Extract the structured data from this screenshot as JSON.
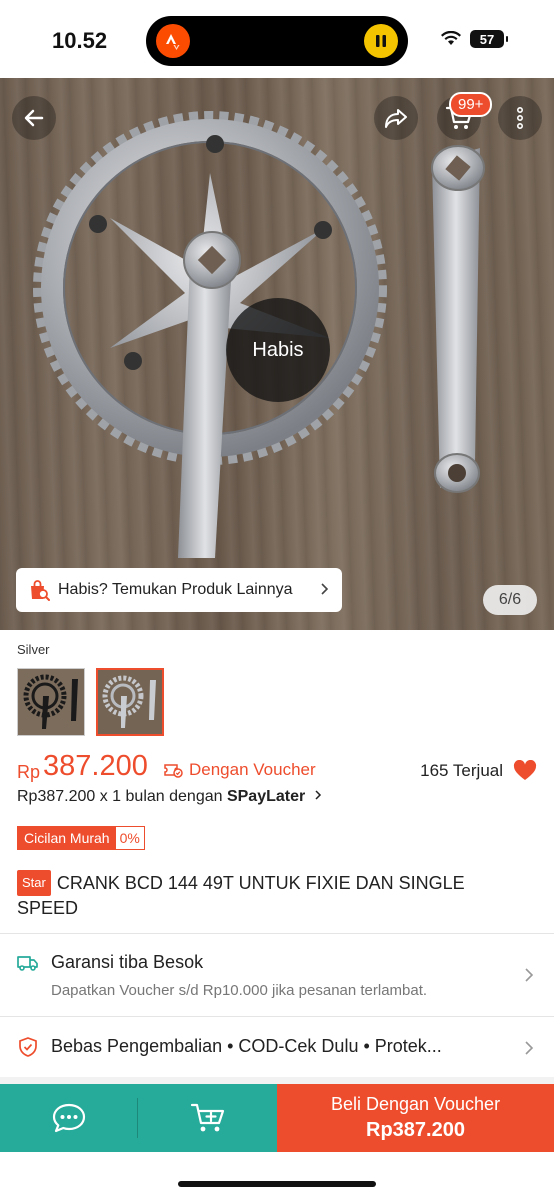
{
  "status": {
    "time": "10.52",
    "battery": "57"
  },
  "hero": {
    "habis_label": "Habis",
    "find_other_label": "Habis? Temukan Produk Lainnya",
    "image_counter": "6/6",
    "cart_badge": "99+"
  },
  "variant": {
    "label": "Silver",
    "selected_index": 1
  },
  "pricing": {
    "currency": "Rp",
    "price": "387.200",
    "voucher_label": "Dengan Voucher",
    "sold": "165 Terjual",
    "installment_prefix": "Rp387.200 x 1 bulan dengan ",
    "installment_brand": "SPayLater",
    "cicilan_label": "Cicilan Murah",
    "cicilan_rate": "0%"
  },
  "product": {
    "tag": "Star",
    "title": "CRANK BCD 144 49T UNTUK FIXIE DAN SINGLE SPEED"
  },
  "shipping": {
    "title": "Garansi tiba Besok",
    "subtitle": "Dapatkan Voucher s/d Rp10.000 jika pesanan terlambat."
  },
  "features": {
    "text": "Bebas Pengembalian  •  COD-Cek Dulu  •  Protek..."
  },
  "bottom": {
    "buy_label": "Beli Dengan Voucher",
    "buy_price": "Rp387.200"
  },
  "colors": {
    "accent": "#ee4d2d",
    "teal": "#26aa99"
  }
}
